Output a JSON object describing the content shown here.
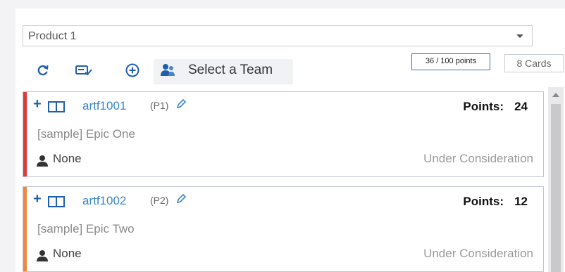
{
  "product_select": {
    "value": "Product 1"
  },
  "toolbar": {
    "refresh_icon": "refresh-icon",
    "edit_icon": "edit-check-icon",
    "add_icon": "add-circle-icon",
    "team_icon": "team-icon",
    "team_label": "Select a Team"
  },
  "summary": {
    "points": "36 / 100 points",
    "cards": "8 Cards"
  },
  "colors": {
    "accent": "#1f5fae",
    "link": "#3b86c9",
    "stripe_red": "#e0393b",
    "stripe_orange": "#f0883a"
  },
  "cards": [
    {
      "id": "artf1001",
      "priority": "(P1)",
      "points_label": "Points:",
      "points": "24",
      "title": "[sample] Epic One",
      "owner": "None",
      "status": "Under Consideration",
      "stripe_color": "#e0393b"
    },
    {
      "id": "artf1002",
      "priority": "(P2)",
      "points_label": "Points:",
      "points": "12",
      "title": "[sample] Epic Two",
      "owner": "None",
      "status": "Under Consideration",
      "stripe_color": "#f0883a"
    }
  ]
}
